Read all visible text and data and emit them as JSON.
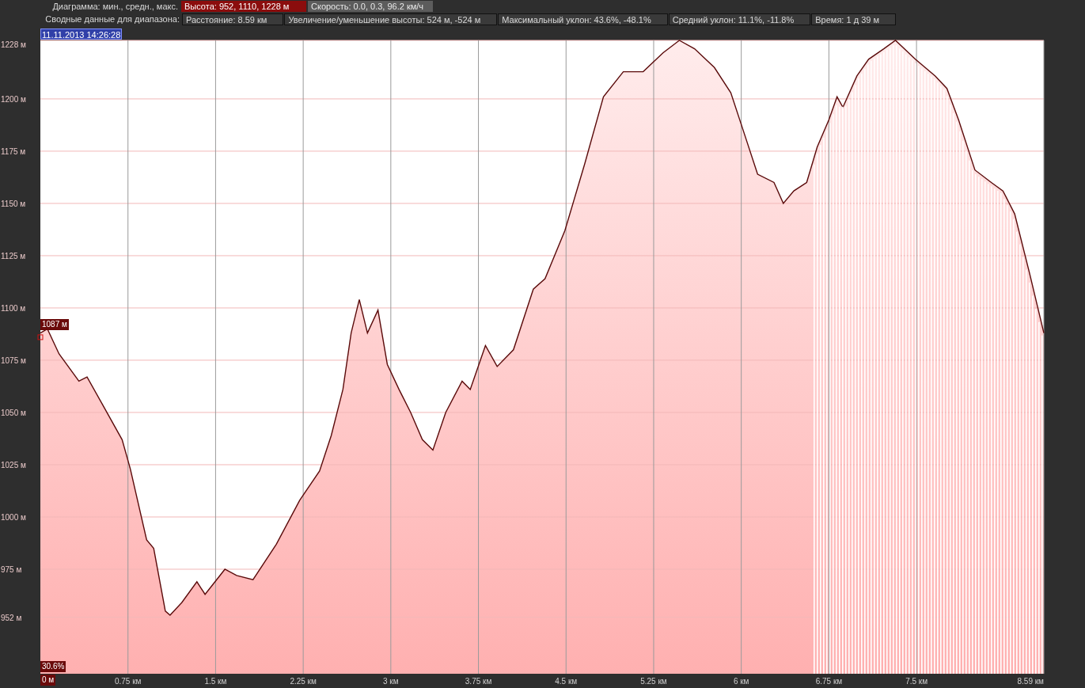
{
  "chart_header": {
    "label": "Диаграмма: мин., средн., макс.",
    "series_buttons": [
      {
        "label": "Высота: 952, 1110, 1228 м",
        "selected": true
      },
      {
        "label": "Скорость: 0.0, 0.3, 96.2 км/ч",
        "selected": false
      }
    ]
  },
  "range_summary": {
    "label": "Сводные данные для диапазона:",
    "items": [
      "Расстояние: 8.59 км",
      "Увеличение/уменьшение высоты: 524 м, -524 м",
      "Максимальный уклон: 43.6%, -48.1%",
      "Средний уклон: 11.1%, -11.8%",
      "Время: 1 д 39 м"
    ]
  },
  "cursor": {
    "time_label": "11.11.2013 14:26:28",
    "elevation_label": "1087 м",
    "grade_label": "30.6%",
    "distance_label": "0 м"
  },
  "chart_data": {
    "type": "area",
    "x": [
      0,
      0.06,
      0.16,
      0.33,
      0.4,
      0.53,
      0.7,
      0.77,
      0.91,
      0.97,
      1.07,
      1.11,
      1.21,
      1.34,
      1.41,
      1.58,
      1.68,
      1.82,
      2.02,
      2.22,
      2.39,
      2.49,
      2.59,
      2.66,
      2.73,
      2.8,
      2.89,
      2.97,
      3.07,
      3.17,
      3.27,
      3.36,
      3.47,
      3.61,
      3.68,
      3.81,
      3.91,
      4.05,
      4.22,
      4.32,
      4.49,
      4.66,
      4.82,
      4.99,
      5.16,
      5.33,
      5.47,
      5.6,
      5.77,
      5.91,
      6.01,
      6.14,
      6.28,
      6.36,
      6.45,
      6.56,
      6.65,
      6.75,
      6.82,
      6.87,
      6.99,
      7.09,
      7.22,
      7.32,
      7.49,
      7.66,
      7.76,
      7.86,
      8.0,
      8.14,
      8.24,
      8.34,
      8.47,
      8.59
    ],
    "series": [
      {
        "color": "#5a0a0a",
        "values": [
          1088,
          1090,
          1078,
          1065,
          1067,
          1054,
          1037,
          1023,
          989,
          985,
          955,
          953,
          959,
          969,
          963,
          975,
          972,
          970,
          987,
          1008,
          1022,
          1039,
          1061,
          1088,
          1104,
          1088,
          1099,
          1073,
          1061,
          1050,
          1037,
          1032,
          1050,
          1065,
          1061,
          1082,
          1072,
          1080,
          1109,
          1114,
          1137,
          1169,
          1201,
          1213,
          1213,
          1222,
          1228,
          1224,
          1215,
          1203,
          1186,
          1164,
          1160,
          1150,
          1156,
          1160,
          1177,
          1190,
          1201,
          1196,
          1211,
          1219,
          1224,
          1228,
          1219,
          1211,
          1205,
          1190,
          1166,
          1160,
          1156,
          1145,
          1116,
          1088
        ]
      }
    ],
    "xlim": [
      0,
      8.59
    ],
    "ylim": [
      925,
      1228
    ],
    "xticks": [
      {
        "value": 0.75,
        "label": "0.75 км"
      },
      {
        "value": 1.5,
        "label": "1.5 км"
      },
      {
        "value": 2.25,
        "label": "2.25 км"
      },
      {
        "value": 3,
        "label": "3 км"
      },
      {
        "value": 3.75,
        "label": "3.75 км"
      },
      {
        "value": 4.5,
        "label": "4.5 км"
      },
      {
        "value": 5.25,
        "label": "5.25 км"
      },
      {
        "value": 6,
        "label": "6 км"
      },
      {
        "value": 6.75,
        "label": "6.75 км"
      },
      {
        "value": 7.5,
        "label": "7.5 км"
      },
      {
        "value": 8.59,
        "label": "8.59 км"
      }
    ],
    "yticks": [
      {
        "value": 952,
        "label": "952 м"
      },
      {
        "value": 975,
        "label": "975 м"
      },
      {
        "value": 1000,
        "label": "1000 м"
      },
      {
        "value": 1025,
        "label": "1025 м"
      },
      {
        "value": 1050,
        "label": "1050 м"
      },
      {
        "value": 1075,
        "label": "1075 м"
      },
      {
        "value": 1100,
        "label": "1100 м"
      },
      {
        "value": 1125,
        "label": "1125 м"
      },
      {
        "value": 1150,
        "label": "1150 м"
      },
      {
        "value": 1175,
        "label": "1175 м"
      },
      {
        "value": 1200,
        "label": "1200 м"
      },
      {
        "value": 1228,
        "label": "1228 м"
      }
    ],
    "grid": true
  },
  "range_selection": {
    "level": 0.23
  }
}
